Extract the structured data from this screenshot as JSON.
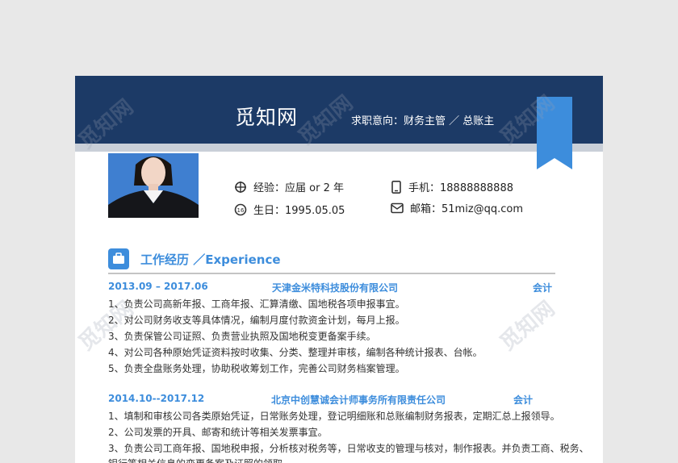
{
  "header": {
    "brand": "觅知网",
    "job_intent": "求职意向：财务主管 ／ 总账主"
  },
  "watermark": "觅知网",
  "info": {
    "experience": "经验：应届  or 2 年",
    "birthday": "生日：1995.05.05",
    "phone": "手机：18888888888",
    "email": "邮箱：51miz@qq.com"
  },
  "section": {
    "title": "工作经历 ／Experience"
  },
  "jobs": [
    {
      "period": "2013.09  –  2017.06",
      "company": "天津金米特科技股份有限公司",
      "role": "会计",
      "duties": [
        "1、负责公司高新年报、工商年报、汇算清缴、国地税各项申报事宜。",
        "2、对公司财务收支等具体情况，编制月度付款资金计划，每月上报。",
        "3、负责保管公司证照、负责营业执照及国地税变更备案手续。",
        "4、对公司各种原始凭证资料按时收集、分类、整理并审核，编制各种统计报表、台帐。",
        "5、负责全盘账务处理，协助税收筹划工作，完善公司财务档案管理。"
      ]
    },
    {
      "period": "2014.10--2017.12",
      "company": "北京中创慧诚会计师事务所有限责任公司",
      "role": "会计",
      "duties": [
        "1、填制和审核公司各类原始凭证，日常账务处理，登记明细账和总账编制财务报表，定期汇总上报领导。",
        "2、公司发票的开具、邮寄和统计等相关发票事宜。",
        "3、负责公司工商年报、国地税申报，分析核对税务等，日常收支的管理与核对，制作报表。并负责工商、税务、",
        "银行等相关信息的变更备案及证照的领取"
      ]
    }
  ]
}
